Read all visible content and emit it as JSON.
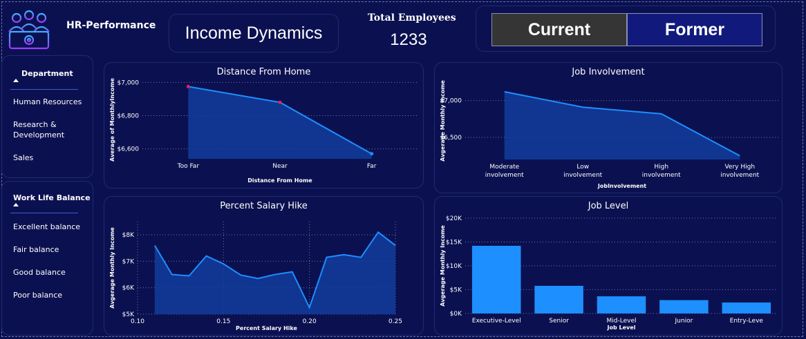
{
  "header": {
    "app_title": "HR-Performance",
    "page_title": "Income Dynamics",
    "kpi_label": "Total Employees",
    "kpi_value": "1233",
    "toggle_current": "Current",
    "toggle_former": "Former"
  },
  "slicers": {
    "department": {
      "title": "Department",
      "items": [
        "Human Resources",
        "Research & Development",
        "Sales"
      ]
    },
    "work_life_balance": {
      "title": "Work Life Balance",
      "items": [
        "Excellent balance",
        "Fair balance",
        "Good balance",
        "Poor balance"
      ]
    }
  },
  "colors": {
    "background": "#0b1150",
    "card_border": "#1f2a74",
    "accent": "#1e8fff",
    "area_fill": "#123d9e",
    "current_button": "#353535",
    "former_button": "#111a7c"
  },
  "chart_data": [
    {
      "type": "area",
      "title": "Distance From Home",
      "xlabel": "Distance From Home",
      "ylabel": "Average of MonthlyIncome",
      "categories": [
        "Too Far",
        "Near",
        "Far"
      ],
      "values": [
        6975,
        6880,
        6570
      ],
      "ylim": [
        6540,
        7010
      ],
      "yticks": [
        6600,
        6800,
        7000
      ],
      "ytick_labels": [
        "$6,600",
        "$6,800",
        "$7,000"
      ],
      "grid": true
    },
    {
      "type": "area",
      "title": "Job Involvement",
      "xlabel": "JobInvolvement",
      "ylabel": "Avgerage Monthly Income",
      "categories": [
        "Moderate involvement",
        "Low involvement",
        "High involvement",
        "Very High involvement"
      ],
      "values": [
        7120,
        6910,
        6820,
        6250
      ],
      "ylim": [
        6200,
        7250
      ],
      "yticks": [
        6500,
        7000
      ],
      "ytick_labels": [
        "$6,500",
        "$7,000"
      ],
      "grid": true
    },
    {
      "type": "area",
      "title": "Percent Salary Hike",
      "xlabel": "Percent Salary Hike",
      "ylabel": "Avgerage Monthly Income",
      "x": [
        0.11,
        0.12,
        0.13,
        0.14,
        0.15,
        0.16,
        0.17,
        0.18,
        0.19,
        0.2,
        0.21,
        0.22,
        0.23,
        0.24,
        0.25
      ],
      "values": [
        7600,
        6500,
        6450,
        7200,
        6900,
        6480,
        6350,
        6500,
        6600,
        5250,
        7150,
        7250,
        7150,
        8100,
        7600
      ],
      "xlim": [
        0.1,
        0.25
      ],
      "xticks": [
        0.1,
        0.15,
        0.2,
        0.25
      ],
      "xtick_labels": [
        "0.10",
        "0.15",
        "0.20",
        "0.25"
      ],
      "ylim": [
        5000,
        8500
      ],
      "yticks": [
        5000,
        6000,
        7000,
        8000
      ],
      "ytick_labels": [
        "$5K",
        "$6K",
        "$7K",
        "$8K"
      ],
      "grid": true
    },
    {
      "type": "bar",
      "title": "Job Level",
      "xlabel": "Job Level",
      "ylabel": "Avgerage Monthly Income",
      "categories": [
        "Executive-Level",
        "Senior",
        "Mid-Level",
        "Junior",
        "Entry-Leve"
      ],
      "values": [
        14200,
        5800,
        3600,
        2800,
        2300
      ],
      "ylim": [
        0,
        20000
      ],
      "yticks": [
        0,
        5000,
        10000,
        15000,
        20000
      ],
      "ytick_labels": [
        "$0K",
        "$5K",
        "$10K",
        "$15K",
        "$20K"
      ],
      "grid": true
    }
  ]
}
